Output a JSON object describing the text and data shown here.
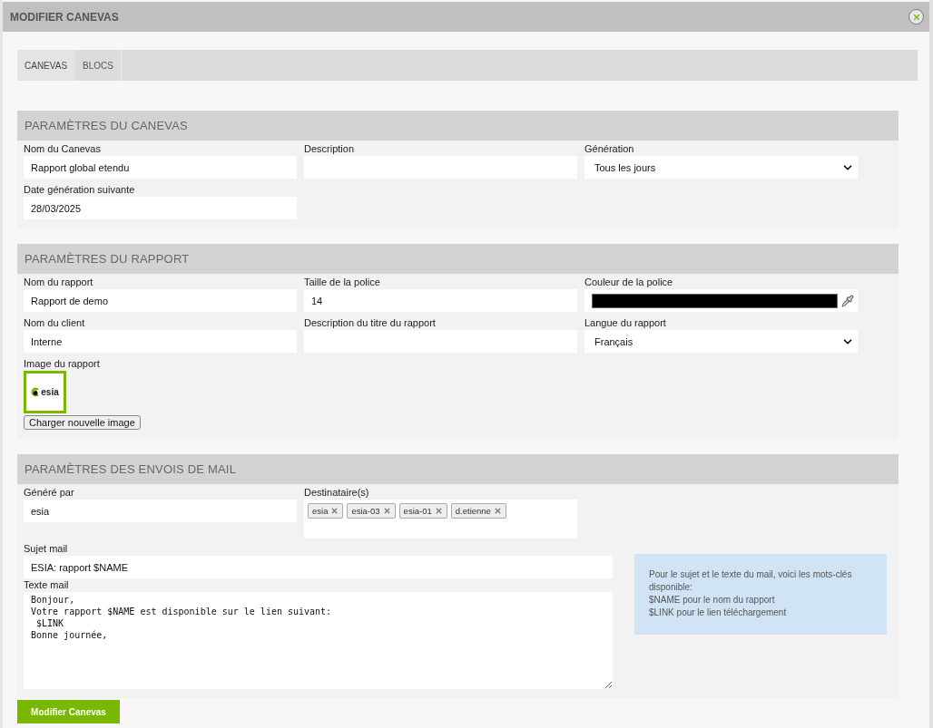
{
  "dialog": {
    "title": "MODIFIER CANEVAS"
  },
  "tabs": [
    {
      "label": "CANEVAS",
      "selected": true
    },
    {
      "label": "BLOCS",
      "selected": false
    }
  ],
  "sections": [
    {
      "title": "PARAMÈTRES DU CANEVAS",
      "fields": [
        {
          "label": "Nom du Canevas",
          "kind": "text",
          "value": "Rapport global etendu"
        },
        {
          "label": "Description",
          "kind": "text"
        },
        {
          "label": "Génération",
          "kind": "select",
          "value": "Tous les jours"
        },
        {
          "label": "Date génération suivante",
          "kind": "text",
          "value": "28/03/2025"
        }
      ]
    },
    {
      "title": "PARAMÈTRES DU RAPPORT",
      "fields": [
        {
          "label": "Nom du rapport",
          "kind": "text",
          "value": "Rapport de demo"
        },
        {
          "label": "Taille de la police",
          "kind": "text",
          "value": "14"
        },
        {
          "label": "Couleur de la police",
          "kind": "color",
          "color": "#000000"
        },
        {
          "label": "Nom du client",
          "kind": "text",
          "value": "Interne"
        },
        {
          "label": "Description du titre du rapport",
          "kind": "text"
        },
        {
          "label": "Langue du rapport",
          "kind": "select",
          "value": "Français"
        },
        {
          "label": "Image du rapport",
          "kind": "image",
          "logo": "esia",
          "button": "Charger nouvelle image"
        }
      ]
    }
  ],
  "mail": {
    "title": "PARAMÈTRES DES ENVOIS DE MAIL",
    "generated_by": {
      "label": "Généré par",
      "value": "esia"
    },
    "recipients": {
      "label": "Destinataire(s)",
      "tags": [
        "esia",
        "esia-03",
        "esia-01",
        "d.etienne"
      ]
    },
    "subject": {
      "label": "Sujet mail",
      "value": "ESIA: rapport $NAME"
    },
    "body": {
      "label": "Texte mail",
      "value": "Bonjour,\nVotre rapport $NAME est disponible sur le lien suivant:\n $LINK\nBonne journée,"
    },
    "info": [
      "Pour le sujet et le texte du mail, voici les mots-clés disponible:",
      "$NAME pour le nom du rapport",
      "$LINK pour le lien téléchargement"
    ]
  },
  "submit": "Modifier Canevas"
}
